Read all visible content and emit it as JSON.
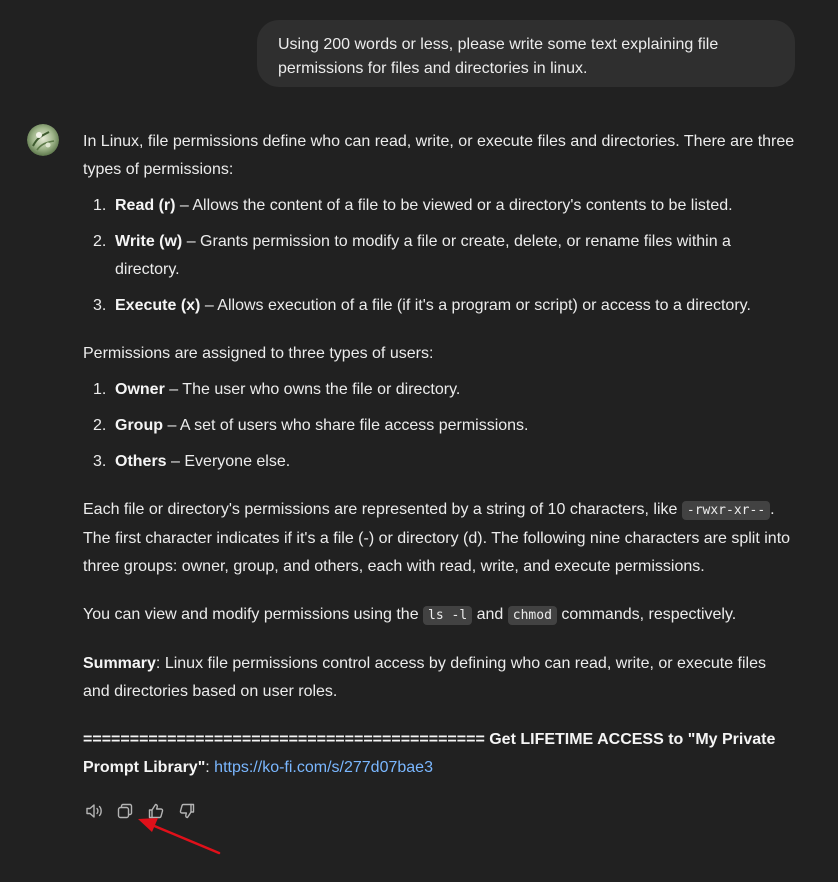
{
  "user_message": {
    "text": "Using 200 words or less, please write some text explaining file permissions for files and directories in linux."
  },
  "assistant": {
    "intro": "In Linux, file permissions define who can read, write, or execute files and directories. There are three types of permissions:",
    "permission_types": [
      {
        "num": "1.",
        "term": "Read (r)",
        "desc": " – Allows the content of a file to be viewed or a directory's contents to be listed."
      },
      {
        "num": "2.",
        "term": "Write (w)",
        "desc": " – Grants permission to modify a file or create, delete, or rename files within a directory."
      },
      {
        "num": "3.",
        "term": "Execute (x)",
        "desc": " – Allows execution of a file (if it's a program or script) or access to a directory."
      }
    ],
    "users_intro": "Permissions are assigned to three types of users:",
    "user_types": [
      {
        "num": "1.",
        "term": "Owner",
        "desc": " – The user who owns the file or directory."
      },
      {
        "num": "2.",
        "term": "Group",
        "desc": " – A set of users who share file access permissions."
      },
      {
        "num": "3.",
        "term": "Others",
        "desc": " – Everyone else."
      }
    ],
    "representation": {
      "before": "Each file or directory's permissions are represented by a string of 10 characters, like ",
      "code": "-rwxr-xr--",
      "after": ". The first character indicates if it's a file (-) or directory (d). The following nine characters are split into three groups: owner, group, and others, each with read, write, and execute permissions."
    },
    "commands": {
      "before": "You can view and modify permissions using the ",
      "code1": "ls -l",
      "middle": " and ",
      "code2": "chmod",
      "after": " commands, respectively."
    },
    "summary": {
      "label": "Summary",
      "text": ": Linux file permissions control access by defining who can read, write, or execute files and directories based on user roles."
    },
    "promo": {
      "bold": "=========================================== Get LIFETIME ACCESS to \"My Private Prompt Library\"",
      "colon": ": ",
      "link": "https://ko-fi.com/s/277d07bae3"
    }
  },
  "toolbar": {
    "icons": [
      "read-aloud-icon",
      "copy-icon",
      "thumbs-up-icon",
      "thumbs-down-icon"
    ]
  },
  "colors": {
    "background": "#212121",
    "user_bubble": "#2f2f2f",
    "text": "#ececec",
    "link": "#7ab7ff",
    "annotation_arrow": "#e0101a"
  }
}
